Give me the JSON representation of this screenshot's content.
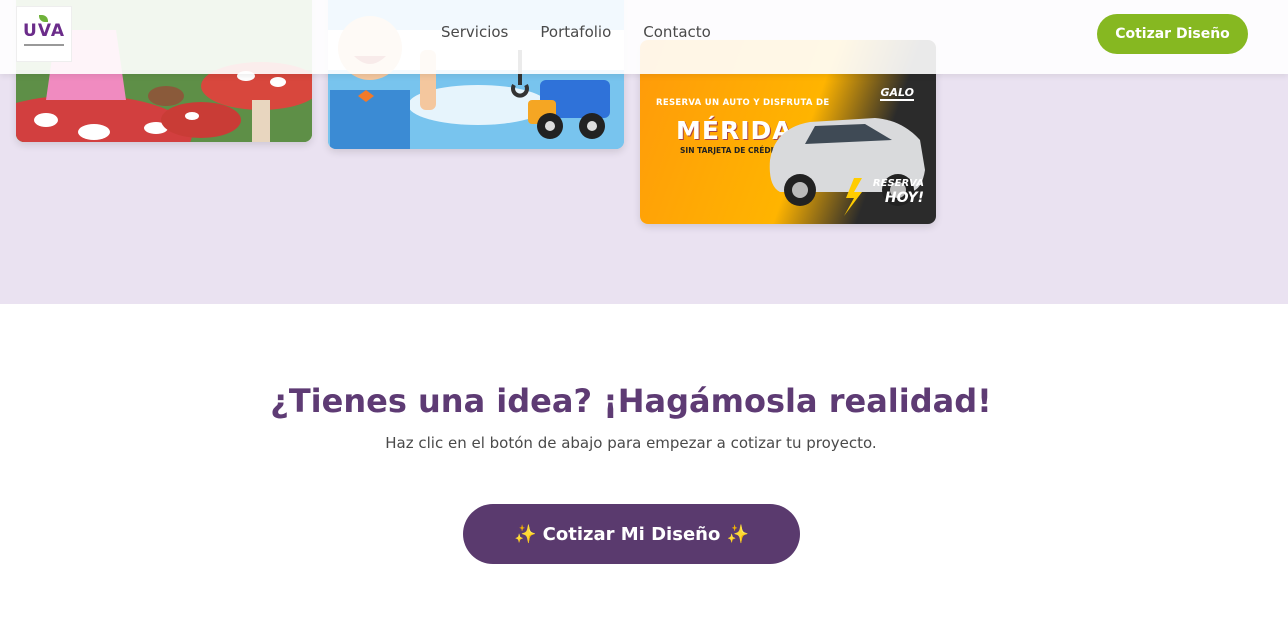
{
  "header": {
    "logo_text": "UVA",
    "nav": [
      "Servicios",
      "Portafolio",
      "Contacto"
    ],
    "cta_label": "Cotizar Diseño"
  },
  "portfolio": {
    "ad": {
      "line1": "RESERVA UN AUTO Y DISFRUTA DE",
      "city": "MÉRIDA",
      "line2": "SIN TARJETA DE CRÉDITO",
      "brand": "GALO",
      "reserva": "RESERVA",
      "hoy": "HOY!"
    }
  },
  "cta": {
    "title": "¿Tienes una idea? ¡Hagámosla realidad!",
    "subtitle": "Haz clic en el botón de abajo para empezar a cotizar tu proyecto.",
    "button_label": "✨ Cotizar Mi Diseño ✨"
  },
  "colors": {
    "accent_green": "#86b821",
    "brand_purple": "#5a3a6e",
    "band_bg": "#eae2f1"
  }
}
